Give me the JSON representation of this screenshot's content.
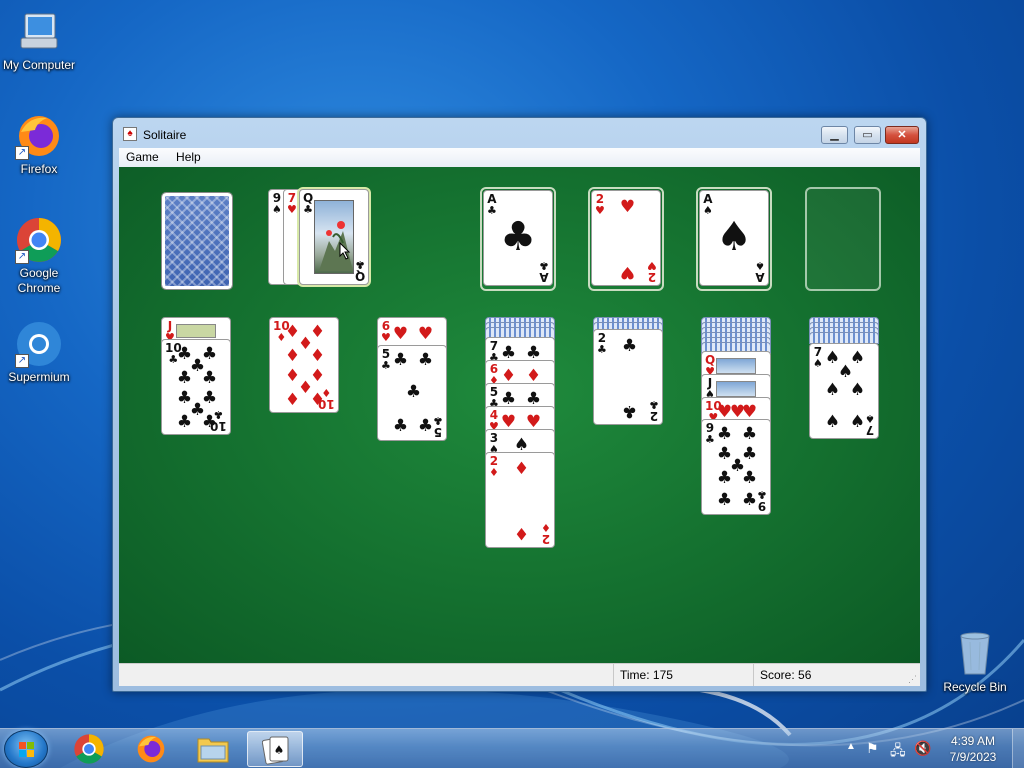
{
  "desktop": {
    "icons": [
      {
        "label": "My Computer",
        "icon": "computer-icon"
      },
      {
        "label": "Firefox",
        "icon": "firefox-icon"
      },
      {
        "label": "Google Chrome",
        "icon": "chrome-icon"
      },
      {
        "label": "Supermium",
        "icon": "supermium-icon"
      },
      {
        "label": "Recycle Bin",
        "icon": "recycle-bin-icon"
      }
    ]
  },
  "window": {
    "title": "Solitaire",
    "menu": [
      "Game",
      "Help"
    ],
    "status": {
      "time_label": "Time:",
      "time_value": "175",
      "score_label": "Score:",
      "score_value": "56"
    }
  },
  "game": {
    "stock": "face-down",
    "waste": [
      "9♠",
      "7♥",
      "Q♣"
    ],
    "foundations": [
      "A♣",
      "2♥",
      "A♠",
      "empty"
    ],
    "tableau": [
      [
        "J♥",
        "10♣"
      ],
      [
        "10♦"
      ],
      [
        "6♥",
        "5♣"
      ],
      [
        "back",
        "back",
        "back",
        "7♣",
        "6♦",
        "5♣",
        "4♥",
        "3♠",
        "2♦"
      ],
      [
        "back",
        "back",
        "2♣"
      ],
      [
        "back",
        "back",
        "back",
        "back",
        "back",
        "back",
        "Q♥",
        "J♠",
        "10♥",
        "9♣"
      ],
      [
        "back",
        "back",
        "back",
        "back",
        "7♠"
      ]
    ]
  },
  "taskbar": {
    "apps": [
      {
        "icon": "chrome-icon"
      },
      {
        "icon": "firefox-icon"
      },
      {
        "icon": "file-explorer-icon"
      },
      {
        "icon": "solitaire-icon",
        "active": true
      }
    ],
    "clock": {
      "time": "4:39 AM",
      "date": "7/9/2023"
    }
  }
}
